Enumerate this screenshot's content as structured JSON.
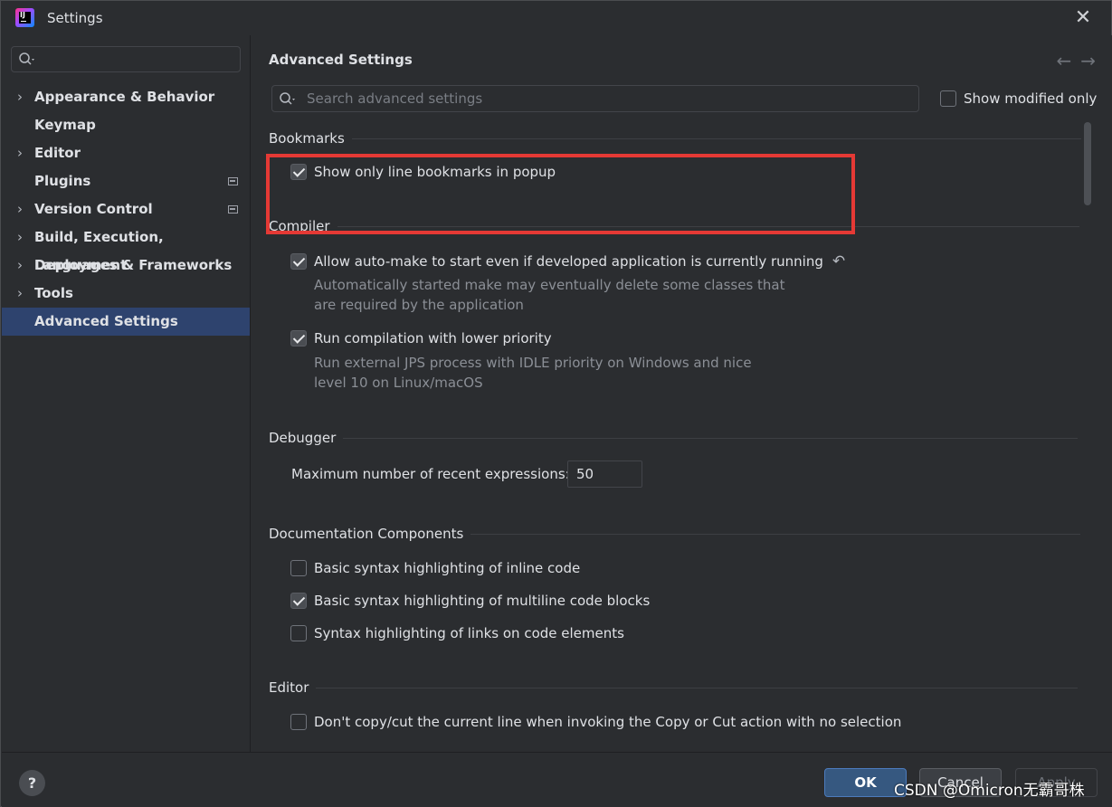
{
  "window": {
    "title": "Settings",
    "close_glyph": "✕"
  },
  "sidebar": {
    "search_placeholder": "",
    "items": [
      {
        "label": "Appearance & Behavior",
        "expandable": true
      },
      {
        "label": "Keymap",
        "expandable": false
      },
      {
        "label": "Editor",
        "expandable": true
      },
      {
        "label": "Plugins",
        "expandable": false,
        "badge": true
      },
      {
        "label": "Version Control",
        "expandable": true,
        "badge": true
      },
      {
        "label": "Build, Execution, Deployment",
        "expandable": true
      },
      {
        "label": "Languages & Frameworks",
        "expandable": true
      },
      {
        "label": "Tools",
        "expandable": true
      },
      {
        "label": "Advanced Settings",
        "expandable": false,
        "selected": true
      }
    ]
  },
  "main": {
    "title": "Advanced Settings",
    "nav_back": "←",
    "nav_forward": "→",
    "search_placeholder": "Search advanced settings",
    "show_modified_only": {
      "label": "Show modified only",
      "checked": false
    },
    "sections": {
      "bookmarks": {
        "title": "Bookmarks",
        "opt1": {
          "label": "Show only line bookmarks in popup",
          "checked": true
        }
      },
      "compiler": {
        "title": "Compiler",
        "opt1": {
          "label": "Allow auto-make to start even if developed application is currently running",
          "checked": true,
          "desc_line1": "Automatically started make may eventually delete some classes that",
          "desc_line2": "are required by the application",
          "revert_glyph": "↶"
        },
        "opt2": {
          "label": "Run compilation with lower priority",
          "checked": true,
          "desc_line1": "Run external JPS process with IDLE priority on Windows and nice",
          "desc_line2": "level 10 on Linux/macOS"
        }
      },
      "debugger": {
        "title": "Debugger",
        "max_expr_label": "Maximum number of recent expressions:",
        "max_expr_value": "50"
      },
      "documentation": {
        "title": "Documentation Components",
        "opt1": {
          "label": "Basic syntax highlighting of inline code",
          "checked": false
        },
        "opt2": {
          "label": "Basic syntax highlighting of multiline code blocks",
          "checked": true
        },
        "opt3": {
          "label": "Syntax highlighting of links on code elements",
          "checked": false
        }
      },
      "editor": {
        "title": "Editor",
        "opt1": {
          "label": "Don't copy/cut the current line when invoking the Copy or Cut action with no selection",
          "checked": false
        }
      }
    }
  },
  "footer": {
    "help": "?",
    "ok": "OK",
    "cancel": "Cancel",
    "apply": "Apply"
  },
  "watermark": "CSDN @Omicron无霸哥株",
  "colors": {
    "background": "#2b2d30",
    "selection": "#2e436e",
    "highlight_box": "#e53935",
    "primary_button": "#365880"
  }
}
